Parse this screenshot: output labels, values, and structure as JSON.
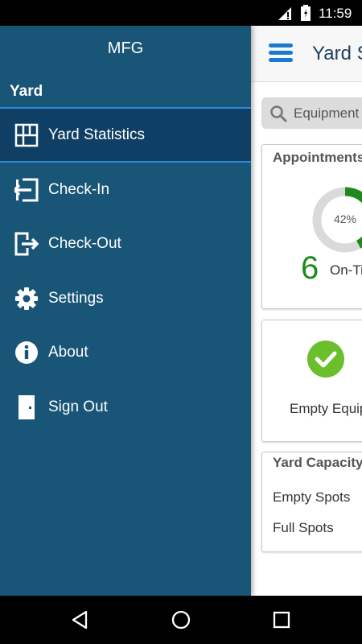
{
  "status_bar": {
    "time": "11:59"
  },
  "app": {
    "title": "Yard Statistics",
    "search": {
      "placeholder": "Equipment"
    },
    "appointments": {
      "title": "Appointments",
      "percent_text": "42%",
      "percent_value": 42,
      "count": "6",
      "label": "On-Time"
    },
    "empty_equipment": {
      "label": "Empty Equipment"
    },
    "yard_capacity": {
      "title": "Yard Capacity",
      "rows": [
        "Empty Spots",
        "Full Spots"
      ]
    },
    "colors": {
      "accent": "#1a7ad0",
      "success": "#1e8a1e",
      "check": "#6cbf2c"
    }
  },
  "drawer": {
    "app_name": "MFG",
    "section_title": "Yard",
    "items": [
      {
        "label": "Yard Statistics",
        "icon": "grid-icon",
        "active": true
      },
      {
        "label": "Check-In",
        "icon": "check-in-icon"
      },
      {
        "label": "Check-Out",
        "icon": "check-out-icon"
      },
      {
        "label": "Settings",
        "icon": "gear-icon"
      },
      {
        "label": "About",
        "icon": "info-icon"
      },
      {
        "label": "Sign Out",
        "icon": "door-icon"
      }
    ],
    "colors": {
      "background": "#195577",
      "active": "#0f3f64",
      "separator": "#2f8ad6"
    }
  },
  "nav_bar": {
    "buttons": [
      "back-icon",
      "home-icon",
      "recent-apps-icon"
    ]
  }
}
